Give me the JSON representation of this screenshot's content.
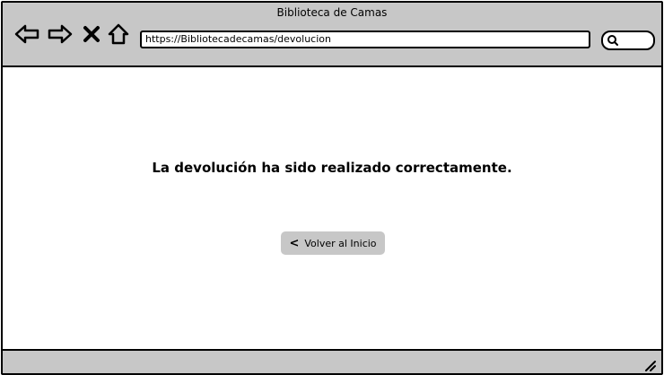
{
  "window": {
    "title": "Biblioteca de Camas"
  },
  "nav": {
    "icons": [
      "back-arrow-icon",
      "forward-arrow-icon",
      "close-icon",
      "home-icon"
    ],
    "url": "https://Bibliotecadecamas/devolucion"
  },
  "search": {
    "icon": "search-icon"
  },
  "main": {
    "message": "La devolución ha sido realizado correctamente.",
    "back_button": {
      "chevron": "<",
      "label": "Volver al Inicio"
    }
  },
  "colors": {
    "chrome": "#c7c7c7",
    "border": "#000000",
    "background": "#ffffff"
  }
}
